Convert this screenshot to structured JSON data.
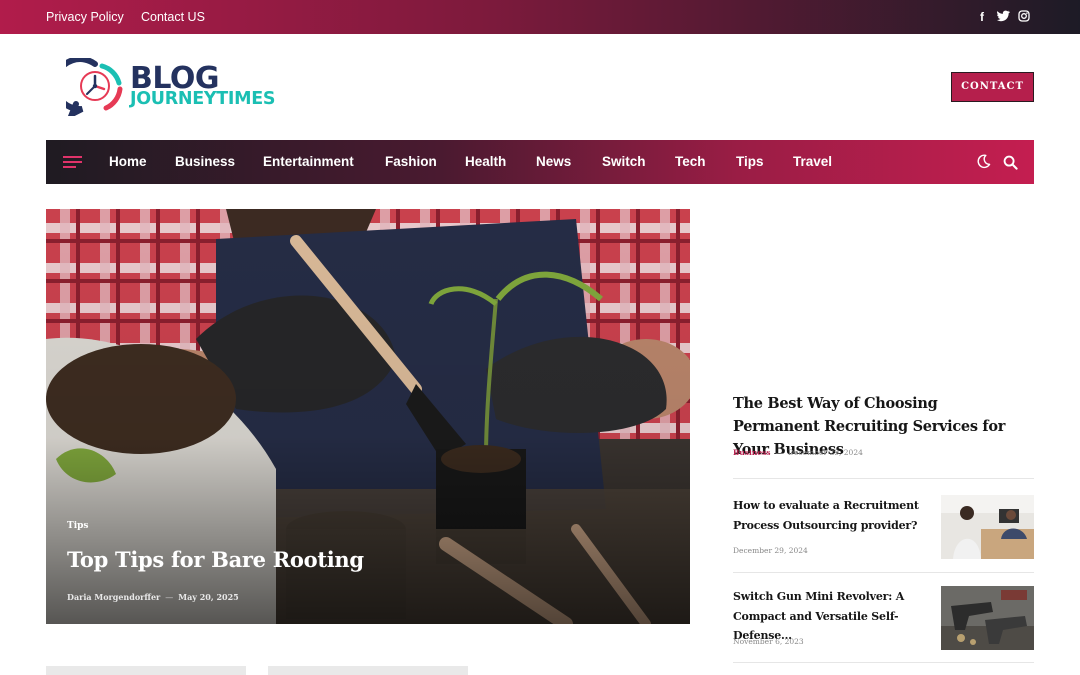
{
  "topbar": {
    "links": [
      "Privacy Policy",
      "Contact US"
    ],
    "social": [
      "facebook-icon",
      "twitter-icon",
      "instagram-icon"
    ]
  },
  "logo": {
    "line1": "BLOG",
    "line2": "JOURNEYTIMES"
  },
  "header": {
    "contact_label": "CONTACT"
  },
  "nav": {
    "items": [
      "Home",
      "Business",
      "Entertainment",
      "Fashion",
      "Health",
      "News",
      "Switch",
      "Tech",
      "Tips",
      "Travel"
    ],
    "icons": [
      "menu-icon",
      "moon-icon",
      "search-icon"
    ]
  },
  "hero": {
    "category": "Tips",
    "title": "Top Tips for Bare Rooting",
    "author": "Daria Morgendorffer",
    "date": "May 20, 2025"
  },
  "sidebar": {
    "featured": {
      "title": "The Best Way of Choosing Permanent Recruiting Services for Your Business",
      "category": "Business",
      "date": "December 29, 2024"
    },
    "items": [
      {
        "title": "How to evaluate a Recruitment Process Outsourcing provider?",
        "date": "December 29, 2024"
      },
      {
        "title": "Switch Gun Mini Revolver: A Compact and Versatile Self-Defense…",
        "date": "November 6, 2023"
      }
    ]
  },
  "colors": {
    "accent": "#b51f4c",
    "logo_navy": "#24325f",
    "logo_teal": "#1bbfb3"
  }
}
